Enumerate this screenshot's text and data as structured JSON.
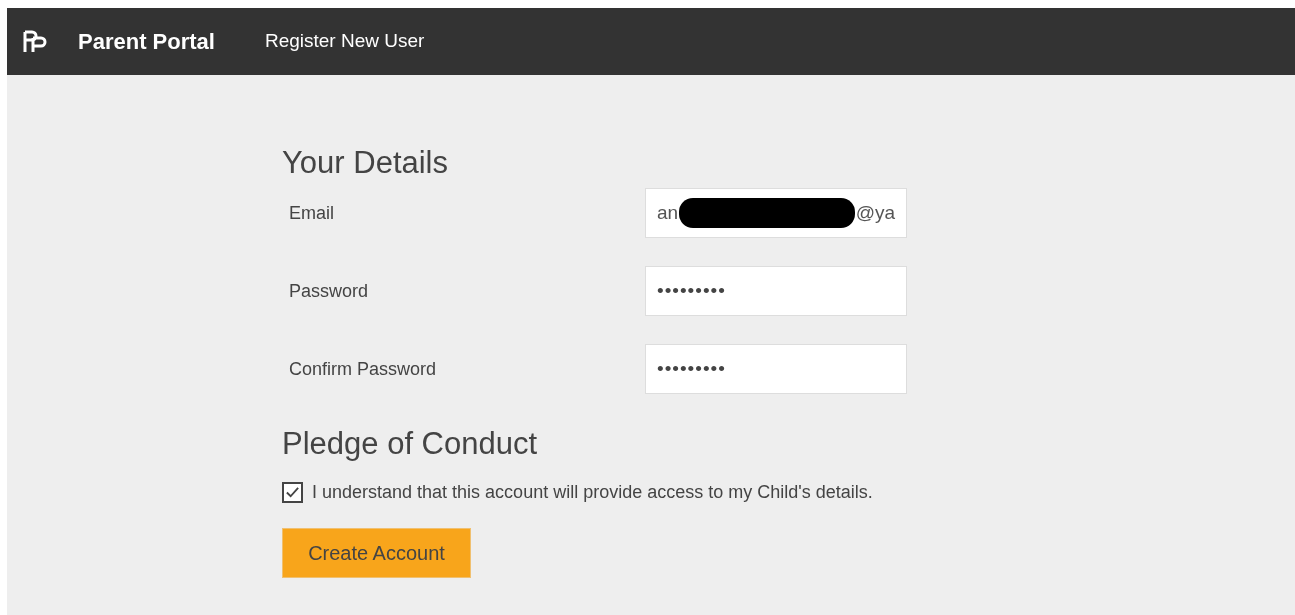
{
  "navbar": {
    "brand": "Parent Portal",
    "links": [
      {
        "label": "Register New User"
      }
    ]
  },
  "details": {
    "heading": "Your Details",
    "fields": [
      {
        "kind": "email",
        "label": "Email",
        "value_start": "an",
        "value_end": "@ya",
        "redacted": true
      },
      {
        "kind": "password",
        "label": "Password",
        "value": "•••••••••"
      },
      {
        "kind": "password",
        "label": "Confirm Password",
        "value": "•••••••••"
      }
    ]
  },
  "pledge": {
    "heading": "Pledge of Conduct",
    "checkbox": {
      "label": "I understand that this account will provide access to my Child's details.",
      "checked": true
    }
  },
  "submit": {
    "label": "Create Account"
  }
}
